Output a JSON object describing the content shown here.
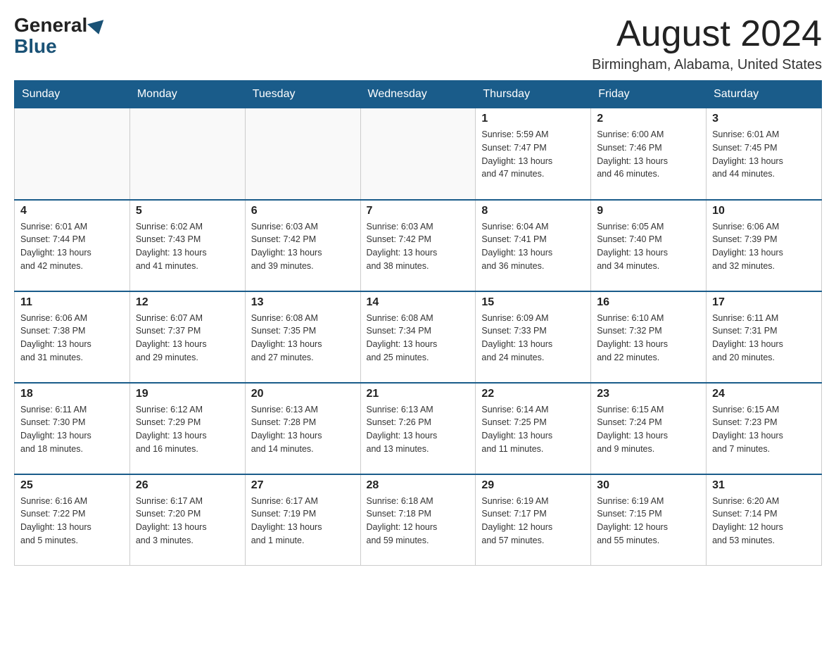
{
  "header": {
    "logo_general": "General",
    "logo_blue": "Blue",
    "month_title": "August 2024",
    "location": "Birmingham, Alabama, United States"
  },
  "weekdays": [
    "Sunday",
    "Monday",
    "Tuesday",
    "Wednesday",
    "Thursday",
    "Friday",
    "Saturday"
  ],
  "weeks": [
    [
      {
        "day": "",
        "info": ""
      },
      {
        "day": "",
        "info": ""
      },
      {
        "day": "",
        "info": ""
      },
      {
        "day": "",
        "info": ""
      },
      {
        "day": "1",
        "info": "Sunrise: 5:59 AM\nSunset: 7:47 PM\nDaylight: 13 hours\nand 47 minutes."
      },
      {
        "day": "2",
        "info": "Sunrise: 6:00 AM\nSunset: 7:46 PM\nDaylight: 13 hours\nand 46 minutes."
      },
      {
        "day": "3",
        "info": "Sunrise: 6:01 AM\nSunset: 7:45 PM\nDaylight: 13 hours\nand 44 minutes."
      }
    ],
    [
      {
        "day": "4",
        "info": "Sunrise: 6:01 AM\nSunset: 7:44 PM\nDaylight: 13 hours\nand 42 minutes."
      },
      {
        "day": "5",
        "info": "Sunrise: 6:02 AM\nSunset: 7:43 PM\nDaylight: 13 hours\nand 41 minutes."
      },
      {
        "day": "6",
        "info": "Sunrise: 6:03 AM\nSunset: 7:42 PM\nDaylight: 13 hours\nand 39 minutes."
      },
      {
        "day": "7",
        "info": "Sunrise: 6:03 AM\nSunset: 7:42 PM\nDaylight: 13 hours\nand 38 minutes."
      },
      {
        "day": "8",
        "info": "Sunrise: 6:04 AM\nSunset: 7:41 PM\nDaylight: 13 hours\nand 36 minutes."
      },
      {
        "day": "9",
        "info": "Sunrise: 6:05 AM\nSunset: 7:40 PM\nDaylight: 13 hours\nand 34 minutes."
      },
      {
        "day": "10",
        "info": "Sunrise: 6:06 AM\nSunset: 7:39 PM\nDaylight: 13 hours\nand 32 minutes."
      }
    ],
    [
      {
        "day": "11",
        "info": "Sunrise: 6:06 AM\nSunset: 7:38 PM\nDaylight: 13 hours\nand 31 minutes."
      },
      {
        "day": "12",
        "info": "Sunrise: 6:07 AM\nSunset: 7:37 PM\nDaylight: 13 hours\nand 29 minutes."
      },
      {
        "day": "13",
        "info": "Sunrise: 6:08 AM\nSunset: 7:35 PM\nDaylight: 13 hours\nand 27 minutes."
      },
      {
        "day": "14",
        "info": "Sunrise: 6:08 AM\nSunset: 7:34 PM\nDaylight: 13 hours\nand 25 minutes."
      },
      {
        "day": "15",
        "info": "Sunrise: 6:09 AM\nSunset: 7:33 PM\nDaylight: 13 hours\nand 24 minutes."
      },
      {
        "day": "16",
        "info": "Sunrise: 6:10 AM\nSunset: 7:32 PM\nDaylight: 13 hours\nand 22 minutes."
      },
      {
        "day": "17",
        "info": "Sunrise: 6:11 AM\nSunset: 7:31 PM\nDaylight: 13 hours\nand 20 minutes."
      }
    ],
    [
      {
        "day": "18",
        "info": "Sunrise: 6:11 AM\nSunset: 7:30 PM\nDaylight: 13 hours\nand 18 minutes."
      },
      {
        "day": "19",
        "info": "Sunrise: 6:12 AM\nSunset: 7:29 PM\nDaylight: 13 hours\nand 16 minutes."
      },
      {
        "day": "20",
        "info": "Sunrise: 6:13 AM\nSunset: 7:28 PM\nDaylight: 13 hours\nand 14 minutes."
      },
      {
        "day": "21",
        "info": "Sunrise: 6:13 AM\nSunset: 7:26 PM\nDaylight: 13 hours\nand 13 minutes."
      },
      {
        "day": "22",
        "info": "Sunrise: 6:14 AM\nSunset: 7:25 PM\nDaylight: 13 hours\nand 11 minutes."
      },
      {
        "day": "23",
        "info": "Sunrise: 6:15 AM\nSunset: 7:24 PM\nDaylight: 13 hours\nand 9 minutes."
      },
      {
        "day": "24",
        "info": "Sunrise: 6:15 AM\nSunset: 7:23 PM\nDaylight: 13 hours\nand 7 minutes."
      }
    ],
    [
      {
        "day": "25",
        "info": "Sunrise: 6:16 AM\nSunset: 7:22 PM\nDaylight: 13 hours\nand 5 minutes."
      },
      {
        "day": "26",
        "info": "Sunrise: 6:17 AM\nSunset: 7:20 PM\nDaylight: 13 hours\nand 3 minutes."
      },
      {
        "day": "27",
        "info": "Sunrise: 6:17 AM\nSunset: 7:19 PM\nDaylight: 13 hours\nand 1 minute."
      },
      {
        "day": "28",
        "info": "Sunrise: 6:18 AM\nSunset: 7:18 PM\nDaylight: 12 hours\nand 59 minutes."
      },
      {
        "day": "29",
        "info": "Sunrise: 6:19 AM\nSunset: 7:17 PM\nDaylight: 12 hours\nand 57 minutes."
      },
      {
        "day": "30",
        "info": "Sunrise: 6:19 AM\nSunset: 7:15 PM\nDaylight: 12 hours\nand 55 minutes."
      },
      {
        "day": "31",
        "info": "Sunrise: 6:20 AM\nSunset: 7:14 PM\nDaylight: 12 hours\nand 53 minutes."
      }
    ]
  ]
}
